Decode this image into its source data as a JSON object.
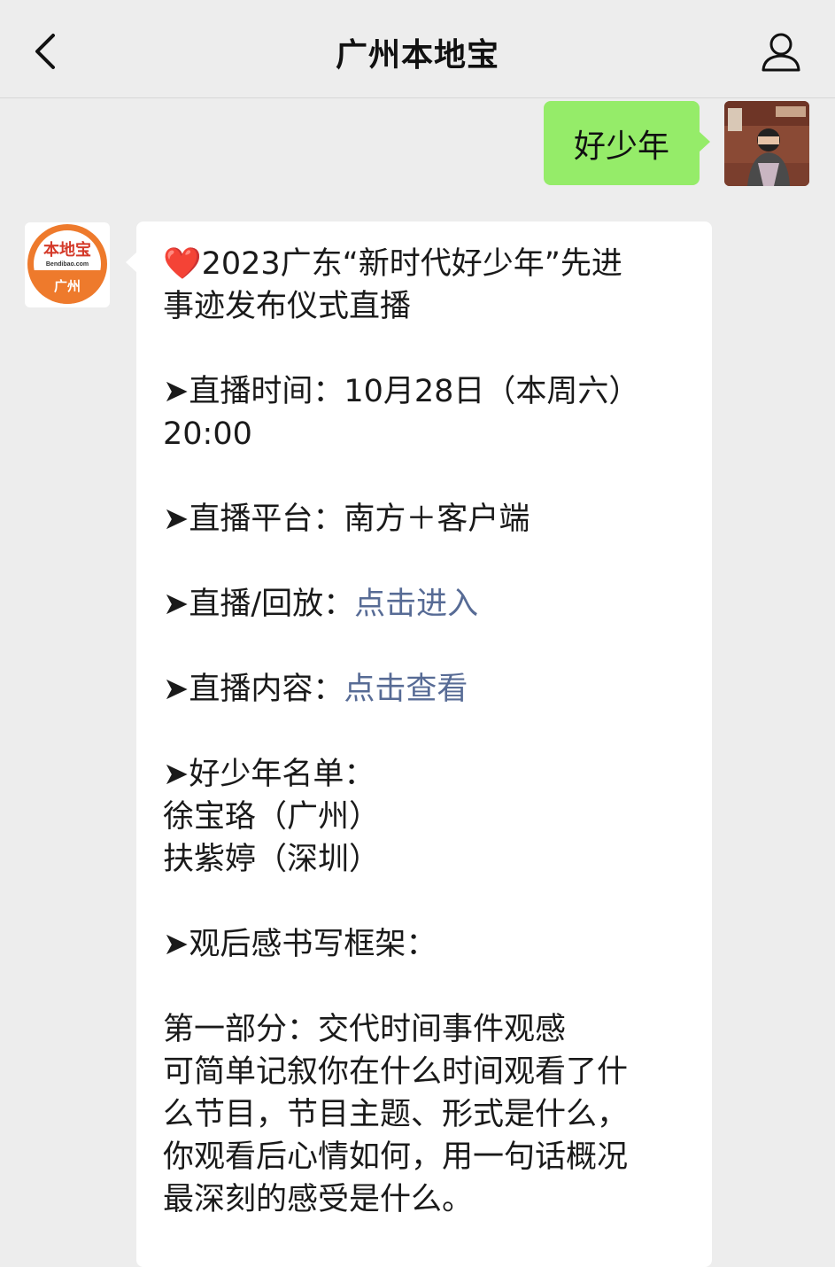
{
  "header": {
    "title": "广州本地宝"
  },
  "outgoing_message": {
    "text": "好少年"
  },
  "incoming_avatar": {
    "logo_text": "本地宝",
    "logo_domain": "Bendibao.com",
    "logo_city": "广州"
  },
  "incoming_message": {
    "heart": "❤️",
    "title_line1": "2023广东“新时代好少年”先进",
    "title_line2": "事迹发布仪式直播",
    "time_label": "➤直播时间：",
    "time_value": "10月28日（本周六）",
    "time_value_2": "20:00",
    "platform_label": "➤直播平台：",
    "platform_value": "南方＋客户端",
    "replay_label": "➤直播/回放：",
    "replay_link": "点击进入",
    "content_label": "➤直播内容：",
    "content_link": "点击查看",
    "list_label": "➤好少年名单：",
    "list": [
      "徐宝珞（广州）",
      "扶紫婷（深圳）"
    ],
    "framework_label": "➤观后感书写框架：",
    "part1_title": "第一部分：交代时间事件观感",
    "part1_lines": [
      "可简单记叙你在什么时间观看了什",
      "么节目，节目主题、形式是什么，",
      "你观看后心情如何，用一句话概况",
      "最深刻的感受是什么。"
    ]
  }
}
